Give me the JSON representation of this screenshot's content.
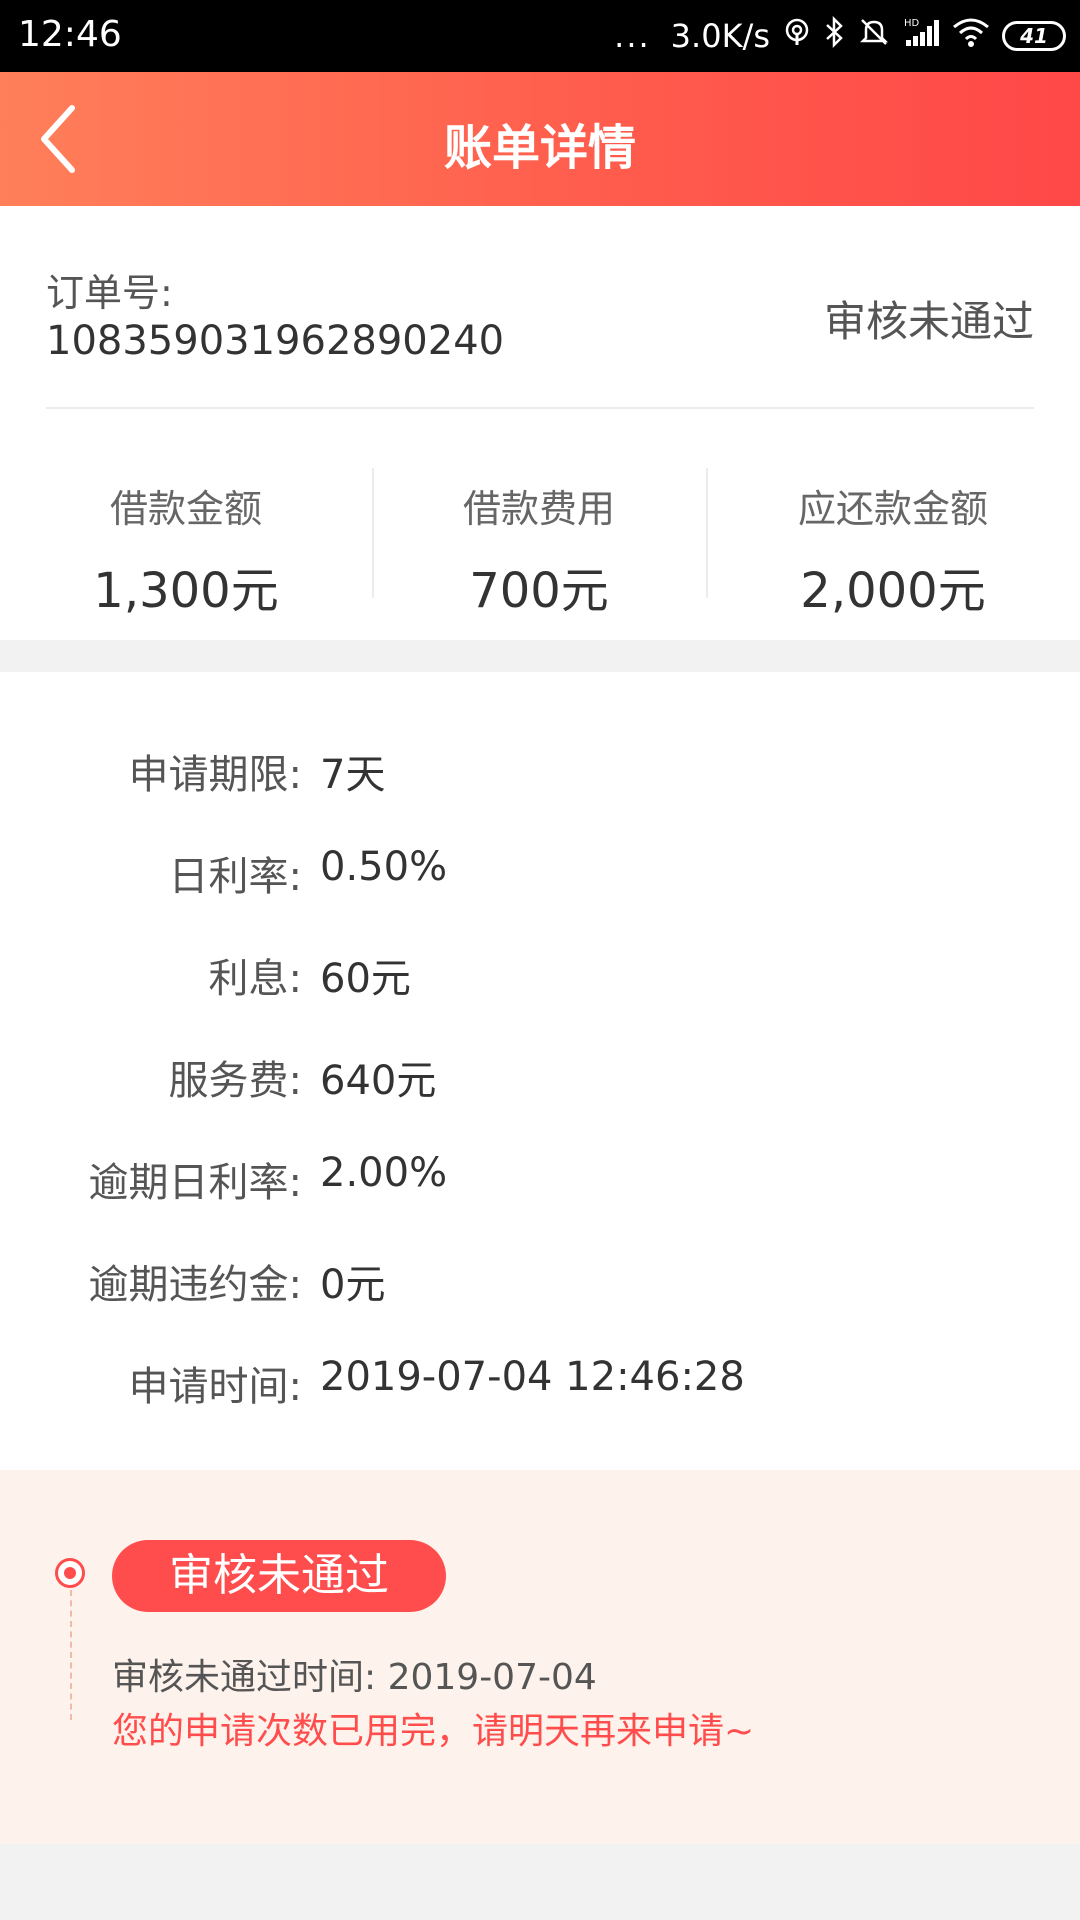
{
  "status_bar": {
    "time": "12:46",
    "more": "...",
    "speed": "3.0K/s",
    "battery": "41",
    "icons": [
      "hotspot-icon",
      "bluetooth-icon",
      "mute-icon",
      "signal-icon",
      "wifi-icon",
      "battery-icon"
    ]
  },
  "header": {
    "title": "账单详情",
    "back_icon": "chevron-left-icon",
    "colors": {
      "start": "#ff7f5a",
      "end": "#ff4848"
    }
  },
  "order": {
    "label": "订单号:",
    "number": "108359031962890240",
    "status": "审核未通过"
  },
  "summary": [
    {
      "label": "借款金额",
      "value": "1,300元"
    },
    {
      "label": "借款费用",
      "value": "700元"
    },
    {
      "label": "应还款金额",
      "value": "2,000元"
    }
  ],
  "details": [
    {
      "label": "申请期限:",
      "value": "7天"
    },
    {
      "label": "日利率:",
      "value": "0.50%"
    },
    {
      "label": "利息:",
      "value": "60元"
    },
    {
      "label": "服务费:",
      "value": "640元"
    },
    {
      "label": "逾期日利率:",
      "value": "2.00%"
    },
    {
      "label": "逾期违约金:",
      "value": "0元"
    },
    {
      "label": "申请时间:",
      "value": "2019-07-04 12:46:28"
    }
  ],
  "review": {
    "badge": "审核未通过",
    "time_text": "审核未通过时间: 2019-07-04",
    "message": "您的申请次数已用完，请明天再来申请~",
    "accent_color": "#ff4d4d"
  }
}
